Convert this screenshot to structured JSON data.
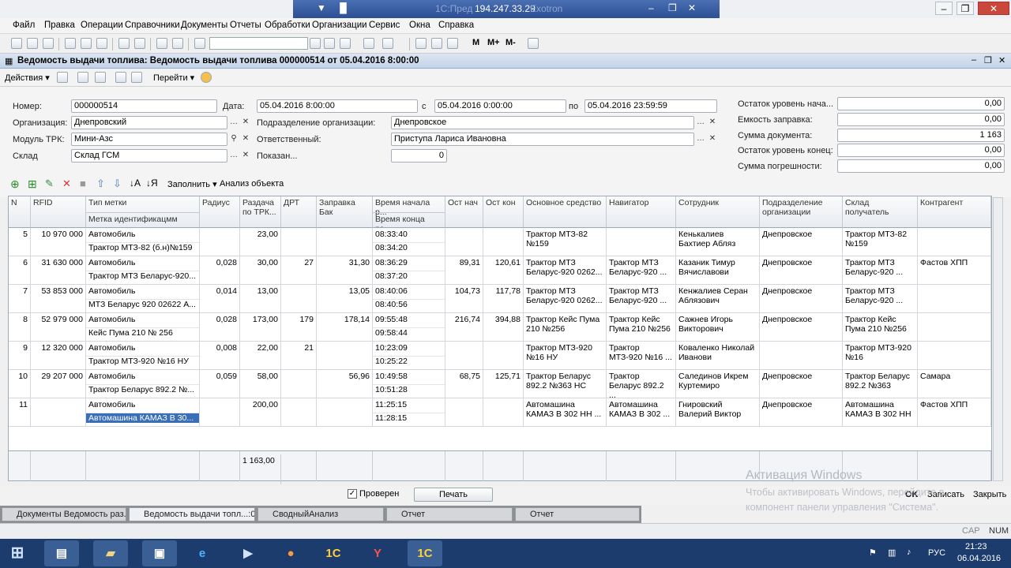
{
  "rdp": {
    "ip": "194.247.33.29",
    "faded_left": "1С:Пред",
    "faded_right": "Exotron"
  },
  "menu": [
    "Файл",
    "Правка",
    "Операции",
    "Справочники",
    "Документы",
    "Отчеты",
    "Обработки",
    "Организации",
    "Сервис",
    "Окна",
    "Справка"
  ],
  "toolbar": {
    "m": "M",
    "mplus": "M+",
    "mminus": "M-"
  },
  "document": {
    "title": "Ведомость выдачи топлива: Ведомость выдачи топлива 000000514 от 05.04.2016 8:00:00"
  },
  "doc_toolbar": {
    "actions": "Действия",
    "goto": "Перейти"
  },
  "form": {
    "number_label": "Номер:",
    "number": "000000514",
    "date_label": "Дата:",
    "date": "05.04.2016  8:00:00",
    "from_label": "с",
    "from": "05.04.2016  0:00:00",
    "to_label": "по",
    "to": "05.04.2016 23:59:59",
    "org_label": "Организация:",
    "org": "Днепровский",
    "dept_label": "Подразделение организации:",
    "dept": "Днепровское",
    "trk_label": "Модуль ТРК:",
    "trk": "Мини-Азс",
    "resp_label": "Ответственный:",
    "resp": "Приступа Лариса Ивановна",
    "wh_label": "Склад",
    "wh": "Склад ГСМ",
    "shown_label": "Показан...",
    "shown": "0",
    "rest_start_label": "Остаток уровень нача...",
    "rest_start": "0,00",
    "cap_label": "Емкость заправка:",
    "cap": "0,00",
    "sum_label": "Сумма документа:",
    "sum": "1 163",
    "rest_end_label": "Остаток уровень конец:",
    "rest_end": "0,00",
    "err_label": "Сумма погрешности:",
    "err": "0,00"
  },
  "table_toolbar": {
    "fill": "Заполнить",
    "analysis": "Анализ объекта"
  },
  "columns": {
    "n": "N",
    "rfid": "RFID",
    "type": "Тип метки",
    "type_sub": "Метка идентификацмм",
    "radius": "Радиус",
    "give": "Раздача по ТРК...",
    "drt": "ДРТ",
    "tank": "Заправка Бак",
    "tstart": "Время начала р...",
    "tend": "Время конца ра...",
    "ost_n": "Ост нач",
    "ost_k": "Ост кон",
    "asset": "Основное средство",
    "nav": "Навигатор",
    "emp": "Сотрудник",
    "dept": "Подразделение организации",
    "wh": "Склад получатель",
    "ctr": "Контрагент"
  },
  "rows": [
    {
      "n": "5",
      "rfid": "10 970 000",
      "type": "Автомобиль",
      "tag": "Трактор МТЗ-82 (б.н)№159",
      "radius": "",
      "give": "23,00",
      "drt": "",
      "tank": "",
      "tstart": "08:33:40",
      "tend": "08:34:20",
      "ost_n": "",
      "ost_k": "",
      "asset": "Трактор МТЗ-82 №159",
      "nav": "",
      "emp": "Кенькалиев Бахтиер Абляз",
      "dept": "Днепровское",
      "wh": "Трактор МТЗ-82 №159",
      "ctr": ""
    },
    {
      "n": "6",
      "rfid": "31 630 000",
      "type": "Автомобиль",
      "tag": "Трактор МТЗ Беларус-920...",
      "radius": "0,028",
      "give": "30,00",
      "drt": "27",
      "tank": "31,30",
      "tstart": "08:36:29",
      "tend": "08:37:20",
      "ost_n": "89,31",
      "ost_k": "120,61",
      "asset": "Трактор МТЗ Беларус-920 0262...",
      "nav": "Трактор МТЗ Беларус-920 ...",
      "emp": "Казаник Тимур Вячиславови",
      "dept": "Днепровское",
      "wh": "Трактор МТЗ Беларус-920 ...",
      "ctr": "Фастов ХПП"
    },
    {
      "n": "7",
      "rfid": "53 853 000",
      "type": "Автомобиль",
      "tag": "МТЗ Беларус 920 02622 А...",
      "radius": "0,014",
      "give": "13,00",
      "drt": "",
      "tank": "13,05",
      "tstart": "08:40:06",
      "tend": "08:40:56",
      "ost_n": "104,73",
      "ost_k": "117,78",
      "asset": "Трактор МТЗ Беларус-920 0262...",
      "nav": "Трактор МТЗ Беларус-920 ...",
      "emp": "Кенжалиев Серан Аблязович",
      "dept": "Днепровское",
      "wh": "Трактор МТЗ Беларус-920 ...",
      "ctr": ""
    },
    {
      "n": "8",
      "rfid": "52 979 000",
      "type": "Автомобиль",
      "tag": "Кейс Пума 210 № 256",
      "radius": "0,028",
      "give": "173,00",
      "drt": "179",
      "tank": "178,14",
      "tstart": "09:55:48",
      "tend": "09:58:44",
      "ost_n": "216,74",
      "ost_k": "394,88",
      "asset": "Трактор Кейс Пума 210 №256",
      "nav": "Трактор Кейс Пума 210 №256",
      "emp": "Сажнев Игорь Викторович",
      "dept": "Днепровское",
      "wh": "Трактор Кейс Пума 210 №256",
      "ctr": ""
    },
    {
      "n": "9",
      "rfid": "12 320 000",
      "type": "Автомобиль",
      "tag": "Трактор МТЗ-920 №16 НУ",
      "radius": "0,008",
      "give": "22,00",
      "drt": "21",
      "tank": "",
      "tstart": "10:23:09",
      "tend": "10:25:22",
      "ost_n": "",
      "ost_k": "",
      "asset": "Трактор МТЗ-920 №16 НУ",
      "nav": "Трактор МТЗ-920 №16 ...",
      "emp": "Коваленко Николай Иванови",
      "dept": "",
      "wh": "Трактор МТЗ-920 №16",
      "ctr": ""
    },
    {
      "n": "10",
      "rfid": "29 207 000",
      "type": "Автомобиль",
      "tag": "Трактор Беларус 892.2 №...",
      "radius": "0,059",
      "give": "58,00",
      "drt": "",
      "tank": "56,96",
      "tstart": "10:49:58",
      "tend": "10:51:28",
      "ost_n": "68,75",
      "ost_k": "125,71",
      "asset": "Трактор Беларус 892.2 №363 НС",
      "nav": "Трактор Беларус 892.2 ...",
      "emp": "Салединов Икрем Куртемиро",
      "dept": "Днепровское",
      "wh": "Трактор Беларус 892.2 №363",
      "ctr": "Самара"
    },
    {
      "n": "11",
      "rfid": "",
      "type": "Автомобиль",
      "tag": "Автомашина КАМАЗ  В 30...",
      "radius": "",
      "give": "200,00",
      "drt": "",
      "tank": "",
      "tstart": "11:25:15",
      "tend": "11:28:15",
      "ost_n": "",
      "ost_k": "",
      "asset": "Автомашина КАМАЗ  В 302 НН ...",
      "nav": "Автомашина КАМАЗ  В 302 ...",
      "emp": "Гнировский Валерий Виктор",
      "dept": "Днепровское",
      "wh": "Автомашина КАМАЗ  В 302 НН",
      "ctr": "Фастов ХПП"
    }
  ],
  "total_give": "1 163,00",
  "bottom": {
    "checked": "Проверен",
    "print": "Печать",
    "ok": "OK",
    "save": "Записать",
    "close": "Закрыть"
  },
  "tabs": [
    "Документы Ведомость раз...",
    "Ведомость выдачи топл...:00",
    "СводныйАнализ",
    "Отчет",
    "Отчет"
  ],
  "status": {
    "cap": "CAP",
    "num": "NUM"
  },
  "watermark": {
    "title": "Активация Windows",
    "line1": "Чтобы активировать Windows, перейдите в",
    "line2": "компонент панели управления \"Система\"."
  },
  "tray": {
    "lang": "РУС",
    "time": "21:23",
    "date": "06.04.2016"
  }
}
